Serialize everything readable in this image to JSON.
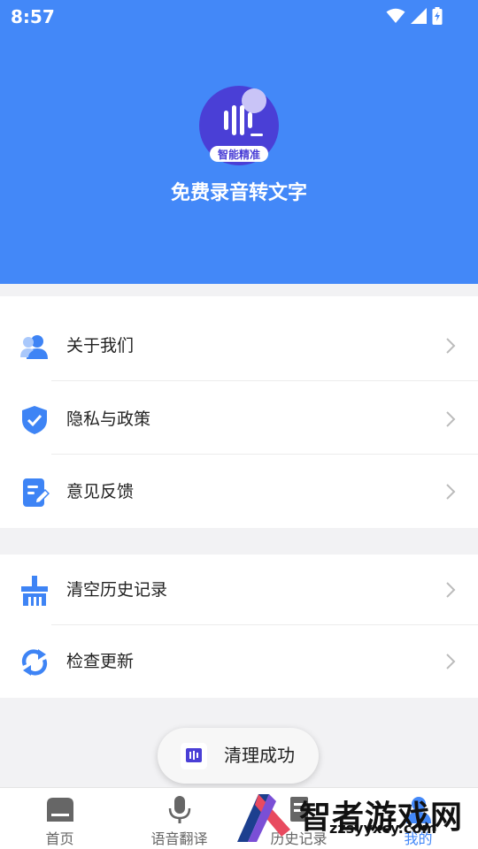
{
  "status_bar": {
    "time": "8:57"
  },
  "header": {
    "title": "免费录音转文字",
    "logo_caption": "智能精准"
  },
  "menu_group_1": [
    {
      "label": "关于我们",
      "icon": "users-icon"
    },
    {
      "label": "隐私与政策",
      "icon": "shield-check-icon"
    },
    {
      "label": "意见反馈",
      "icon": "feedback-edit-icon"
    }
  ],
  "menu_group_2": [
    {
      "label": "清空历史记录",
      "icon": "broom-icon"
    },
    {
      "label": "检查更新",
      "icon": "refresh-icon"
    }
  ],
  "toast": {
    "text": "清理成功"
  },
  "tabbar": [
    {
      "label": "首页",
      "icon": "home-icon"
    },
    {
      "label": "语音翻译",
      "icon": "microphone-icon"
    },
    {
      "label": "历史记录",
      "icon": "history-icon"
    },
    {
      "label": "我的",
      "icon": "profile-icon"
    }
  ],
  "watermark": {
    "text": "智者游戏网",
    "url": "zzsyyxcy.com"
  },
  "colors": {
    "brand_blue": "#4388f8",
    "icon_blue": "#3e84f5"
  }
}
